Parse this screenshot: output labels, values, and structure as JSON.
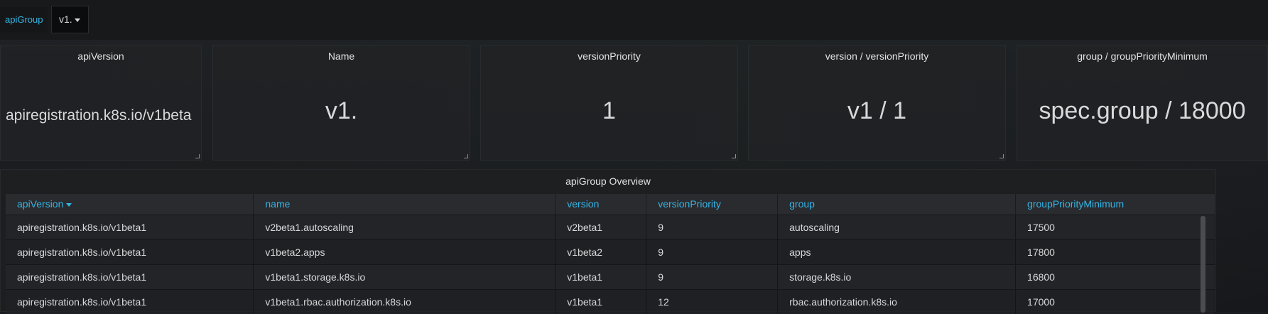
{
  "variables": {
    "label": "apiGroup",
    "selected": "v1."
  },
  "stat_panels": [
    {
      "title": "apiVersion",
      "value": "apiregistration.k8s.io/v1beta"
    },
    {
      "title": "Name",
      "value": "v1."
    },
    {
      "title": "versionPriority",
      "value": "1"
    },
    {
      "title": "version / versionPriority",
      "value": "v1 / 1"
    },
    {
      "title": "group / groupPriorityMinimum",
      "value": "spec.group / 18000"
    }
  ],
  "table": {
    "title": "apiGroup Overview",
    "columns": [
      "apiVersion",
      "name",
      "version",
      "versionPriority",
      "group",
      "groupPriorityMinimum"
    ],
    "rows": [
      [
        "apiregistration.k8s.io/v1beta1",
        "v2beta1.autoscaling",
        "v2beta1",
        "9",
        "autoscaling",
        "17500"
      ],
      [
        "apiregistration.k8s.io/v1beta1",
        "v1beta2.apps",
        "v1beta2",
        "9",
        "apps",
        "17800"
      ],
      [
        "apiregistration.k8s.io/v1beta1",
        "v1beta1.storage.k8s.io",
        "v1beta1",
        "9",
        "storage.k8s.io",
        "16800"
      ],
      [
        "apiregistration.k8s.io/v1beta1",
        "v1beta1.rbac.authorization.k8s.io",
        "v1beta1",
        "12",
        "rbac.authorization.k8s.io",
        "17000"
      ]
    ]
  },
  "colors": {
    "accent": "#33b5e5",
    "text": "#d8d9da",
    "background": "#1a1b1e"
  }
}
